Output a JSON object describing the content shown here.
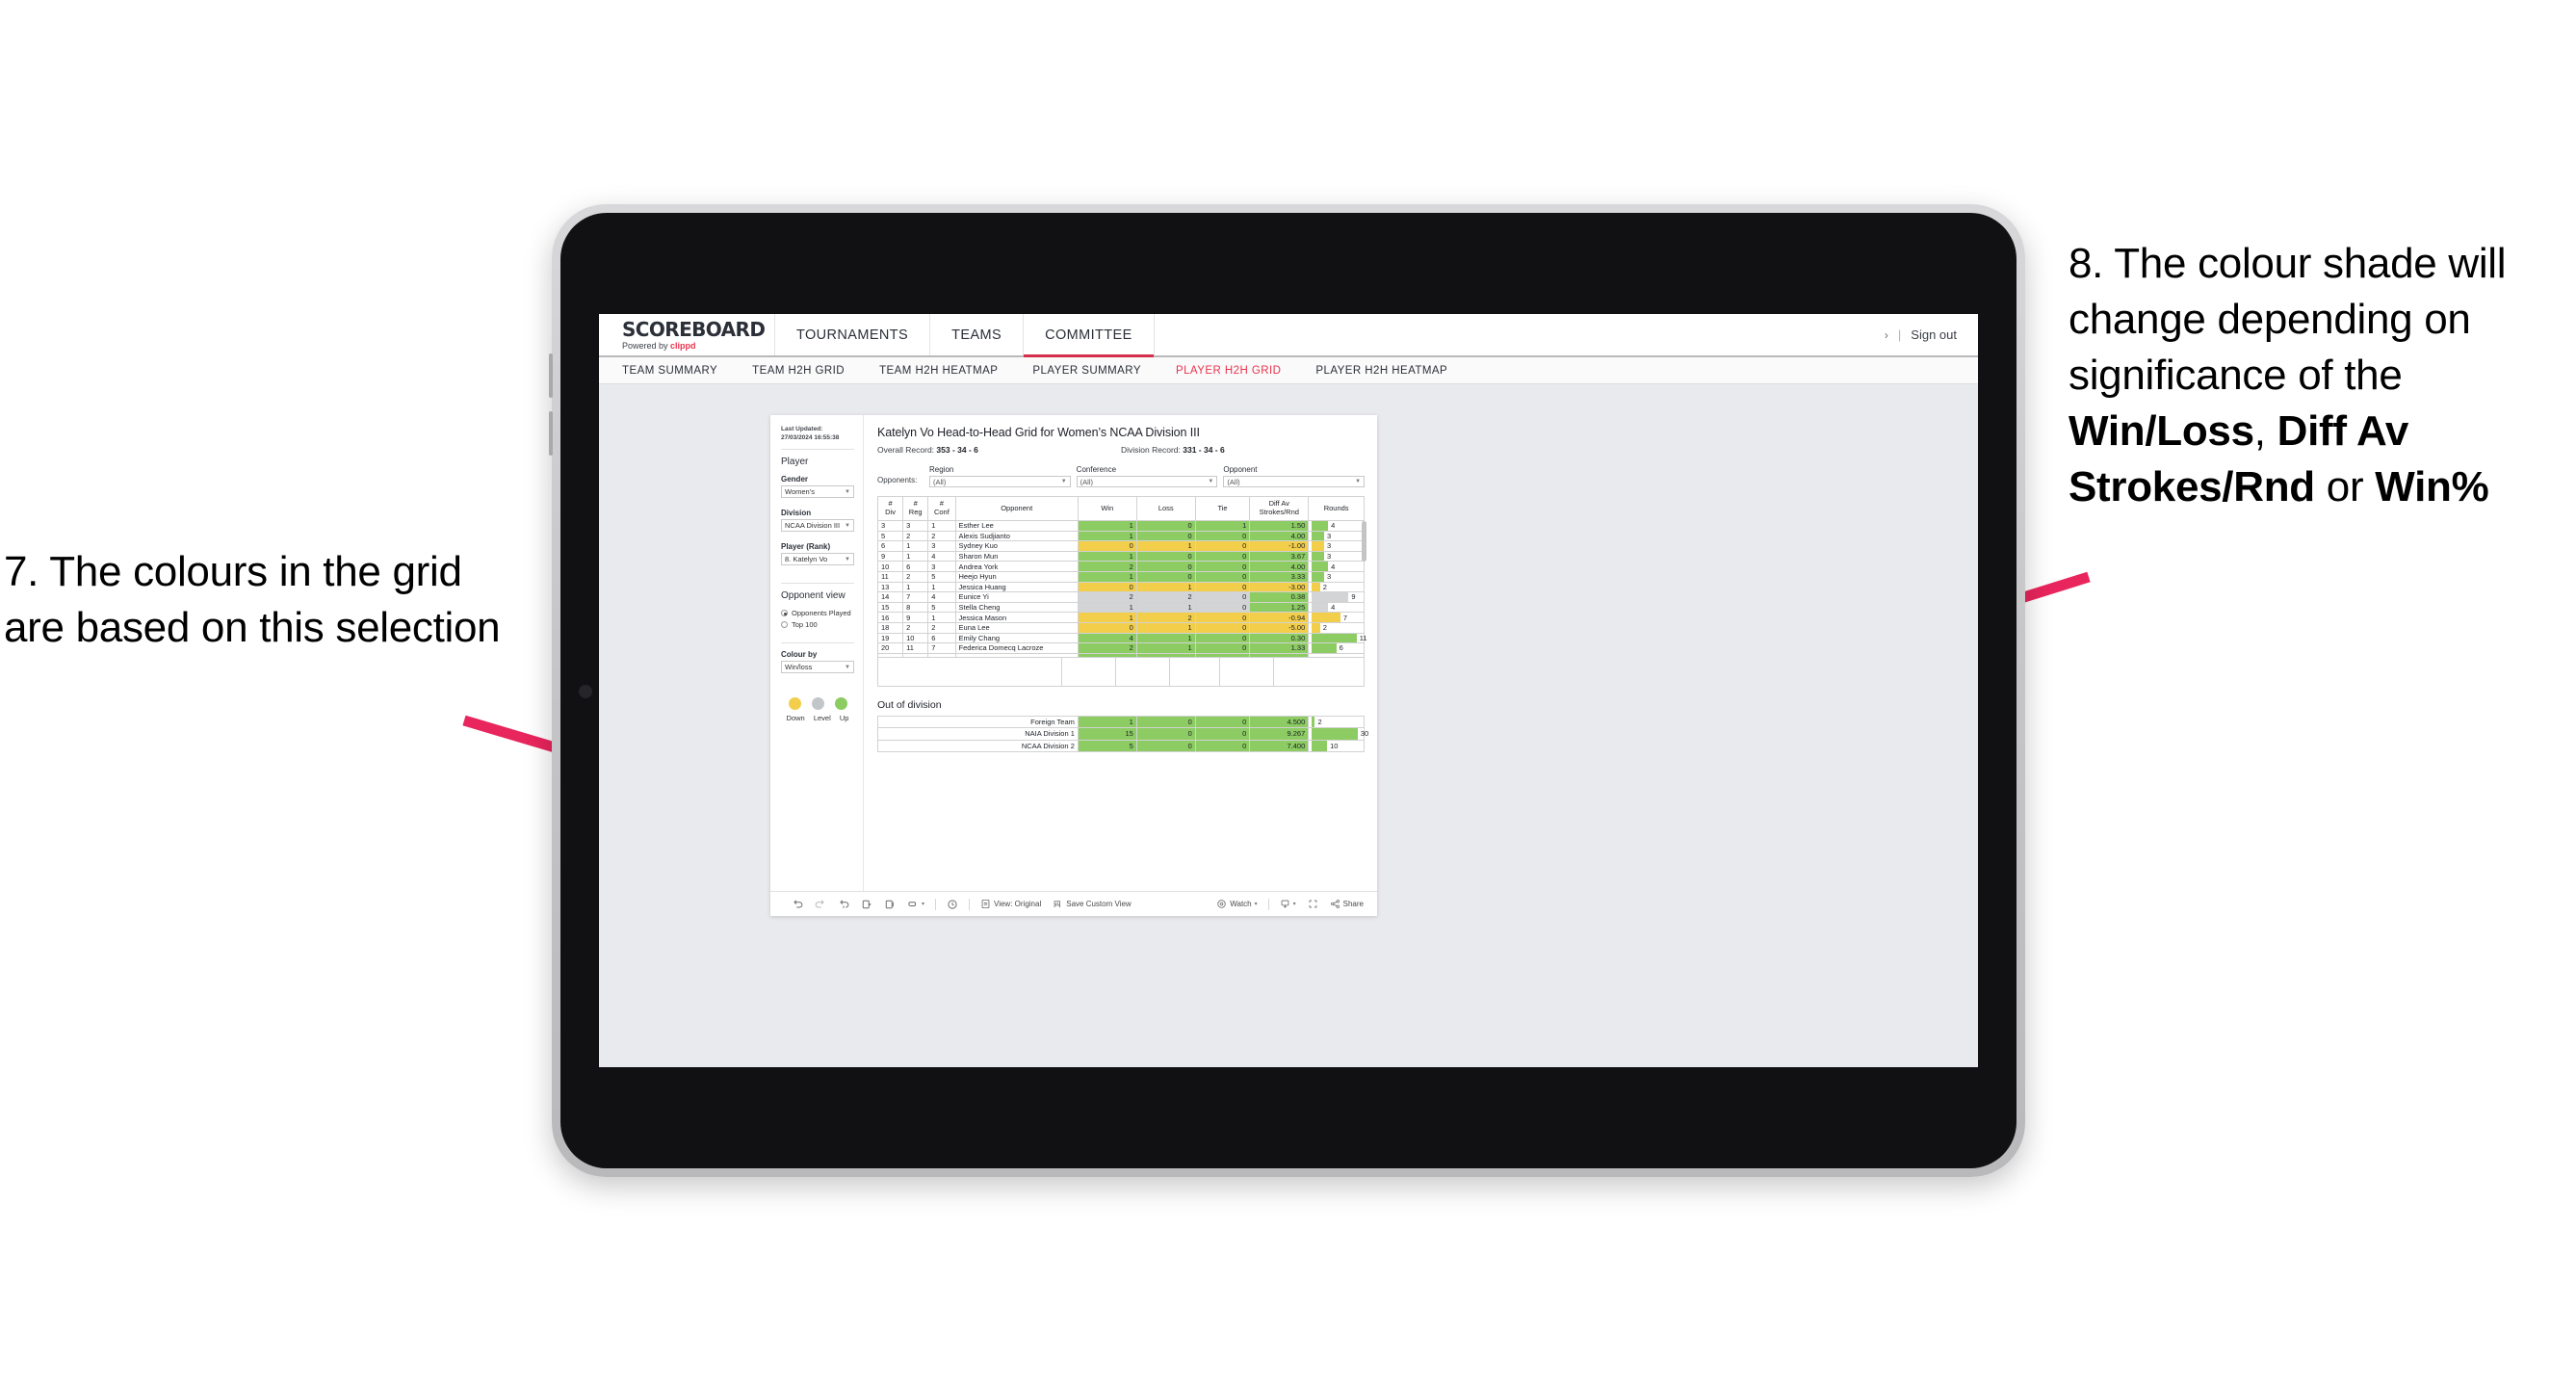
{
  "annotations": {
    "left": {
      "name": "annotation-7",
      "text": "7. The colours in the grid are based on this selection"
    },
    "right": {
      "name": "annotation-8",
      "prefix": "8. The colour shade will change depending on significance of the ",
      "bold1": "Win/Loss",
      "mid1": ", ",
      "bold2": "Diff Av Strokes/Rnd",
      "mid2": " or ",
      "bold3": "Win%"
    },
    "arrow_color": "#e8255c"
  },
  "header": {
    "logo_main": "SCOREBOARD",
    "logo_sub_prefix": "Powered by ",
    "logo_sub_brand": "clippd",
    "nav": [
      {
        "label": "TOURNAMENTS",
        "active": false
      },
      {
        "label": "TEAMS",
        "active": false
      },
      {
        "label": "COMMITTEE",
        "active": true
      }
    ],
    "chevron": "›",
    "separator": "|",
    "sign_out": "Sign out"
  },
  "subnav": [
    {
      "label": "TEAM SUMMARY",
      "active": false
    },
    {
      "label": "TEAM H2H GRID",
      "active": false
    },
    {
      "label": "TEAM H2H HEATMAP",
      "active": false
    },
    {
      "label": "PLAYER SUMMARY",
      "active": false
    },
    {
      "label": "PLAYER H2H GRID",
      "active": true
    },
    {
      "label": "PLAYER H2H HEATMAP",
      "active": false
    }
  ],
  "sidebar": {
    "last_updated": "Last Updated: 27/03/2024 16:55:38",
    "section_player": "Player",
    "gender_label": "Gender",
    "gender_value": "Women’s",
    "division_label": "Division",
    "division_value": "NCAA Division III",
    "player_label": "Player (Rank)",
    "player_value": "8. Katelyn Vo",
    "opponent_view_label": "Opponent view",
    "opponent_view_options": [
      {
        "label": "Opponents Played",
        "selected": true
      },
      {
        "label": "Top 100",
        "selected": false
      }
    ],
    "colour_by_label": "Colour by",
    "colour_by_value": "Win/loss",
    "legend": [
      {
        "label": "Down",
        "color": "#f2ce4b"
      },
      {
        "label": "Level",
        "color": "#c3c6c9"
      },
      {
        "label": "Up",
        "color": "#8ccc63"
      }
    ]
  },
  "main": {
    "title": "Katelyn Vo Head-to-Head Grid for Women’s NCAA Division III",
    "overall_record_label": "Overall Record: ",
    "overall_record_value": "353 -  34 - 6",
    "division_record_label": "Division Record: ",
    "division_record_value": "331 -  34 - 6",
    "opponents_label": "Opponents:",
    "filters": [
      {
        "label": "Region",
        "value": "(All)"
      },
      {
        "label": "Conference",
        "value": "(All)"
      },
      {
        "label": "Opponent",
        "value": "(All)"
      }
    ],
    "out_of_division_title": "Out of division"
  },
  "chart_data": {
    "type": "table",
    "title": "Katelyn Vo Head-to-Head Grid for Women’s NCAA Division III",
    "columns": [
      "# Div",
      "# Reg",
      "# Conf",
      "Opponent",
      "Win",
      "Loss",
      "Tie",
      "Diff Av Strokes/Rnd",
      "Rounds"
    ],
    "column_header_lines": [
      [
        "#",
        "Div"
      ],
      [
        "#",
        "Reg"
      ],
      [
        "#",
        "Conf"
      ],
      [
        "Opponent"
      ],
      [
        "Win"
      ],
      [
        "Loss"
      ],
      [
        "Tie"
      ],
      [
        "Diff Av",
        "Strokes/Rnd"
      ],
      [
        "Rounds"
      ]
    ],
    "rounds_max": 12,
    "colors": {
      "up": "#8ccc63",
      "down": "#f2ce4b",
      "level": "#d2d4d6"
    },
    "rows": [
      {
        "div": "3",
        "reg": "3",
        "conf": "1",
        "opponent": "Esther Lee",
        "win": "1",
        "loss": "0",
        "tie": "1",
        "diff": "1.50",
        "rounds": "4",
        "rounds_num": 4,
        "state": "up"
      },
      {
        "div": "5",
        "reg": "2",
        "conf": "2",
        "opponent": "Alexis Sudjianto",
        "win": "1",
        "loss": "0",
        "tie": "0",
        "diff": "4.00",
        "rounds": "3",
        "rounds_num": 3,
        "state": "up"
      },
      {
        "div": "6",
        "reg": "1",
        "conf": "3",
        "opponent": "Sydney Kuo",
        "win": "0",
        "loss": "1",
        "tie": "0",
        "diff": "-1.00",
        "rounds": "3",
        "rounds_num": 3,
        "state": "down"
      },
      {
        "div": "9",
        "reg": "1",
        "conf": "4",
        "opponent": "Sharon Mun",
        "win": "1",
        "loss": "0",
        "tie": "0",
        "diff": "3.67",
        "rounds": "3",
        "rounds_num": 3,
        "state": "up"
      },
      {
        "div": "10",
        "reg": "6",
        "conf": "3",
        "opponent": "Andrea York",
        "win": "2",
        "loss": "0",
        "tie": "0",
        "diff": "4.00",
        "rounds": "4",
        "rounds_num": 4,
        "state": "up"
      },
      {
        "div": "11",
        "reg": "2",
        "conf": "5",
        "opponent": "Heejo Hyun",
        "win": "1",
        "loss": "0",
        "tie": "0",
        "diff": "3.33",
        "rounds": "3",
        "rounds_num": 3,
        "state": "up"
      },
      {
        "div": "13",
        "reg": "1",
        "conf": "1",
        "opponent": "Jessica Huang",
        "win": "0",
        "loss": "1",
        "tie": "0",
        "diff": "-3.00",
        "rounds": "2",
        "rounds_num": 2,
        "state": "down"
      },
      {
        "div": "14",
        "reg": "7",
        "conf": "4",
        "opponent": "Eunice Yi",
        "win": "2",
        "loss": "2",
        "tie": "0",
        "diff": "0.38",
        "rounds": "9",
        "rounds_num": 9,
        "state": "level",
        "diff_state": "up"
      },
      {
        "div": "15",
        "reg": "8",
        "conf": "5",
        "opponent": "Stella Cheng",
        "win": "1",
        "loss": "1",
        "tie": "0",
        "diff": "1.25",
        "rounds": "4",
        "rounds_num": 4,
        "state": "level",
        "diff_state": "up"
      },
      {
        "div": "16",
        "reg": "9",
        "conf": "1",
        "opponent": "Jessica Mason",
        "win": "1",
        "loss": "2",
        "tie": "0",
        "diff": "-0.94",
        "rounds": "7",
        "rounds_num": 7,
        "state": "down"
      },
      {
        "div": "18",
        "reg": "2",
        "conf": "2",
        "opponent": "Euna Lee",
        "win": "0",
        "loss": "1",
        "tie": "0",
        "diff": "-5.00",
        "rounds": "2",
        "rounds_num": 2,
        "state": "down"
      },
      {
        "div": "19",
        "reg": "10",
        "conf": "6",
        "opponent": "Emily Chang",
        "win": "4",
        "loss": "1",
        "tie": "0",
        "diff": "0.30",
        "rounds": "11",
        "rounds_num": 11,
        "state": "up"
      },
      {
        "div": "20",
        "reg": "11",
        "conf": "7",
        "opponent": "Federica Domecq Lacroze",
        "win": "2",
        "loss": "1",
        "tie": "0",
        "diff": "1.33",
        "rounds": "6",
        "rounds_num": 6,
        "state": "up"
      }
    ],
    "out_of_division": {
      "rounds_max": 32,
      "rows": [
        {
          "name": "Foreign Team",
          "win": "1",
          "loss": "0",
          "tie": "0",
          "diff": "4.500",
          "rounds": "2",
          "rounds_num": 2,
          "state": "up"
        },
        {
          "name": "NAIA Division 1",
          "win": "15",
          "loss": "0",
          "tie": "0",
          "diff": "9.267",
          "rounds": "30",
          "rounds_num": 30,
          "state": "up"
        },
        {
          "name": "NCAA Division 2",
          "win": "5",
          "loss": "0",
          "tie": "0",
          "diff": "7.400",
          "rounds": "10",
          "rounds_num": 10,
          "state": "up"
        }
      ]
    }
  },
  "toolbar": {
    "view_label": "View: Original",
    "save_label": "Save Custom View",
    "watch_label": "Watch",
    "share_label": "Share",
    "caret": "▾"
  }
}
